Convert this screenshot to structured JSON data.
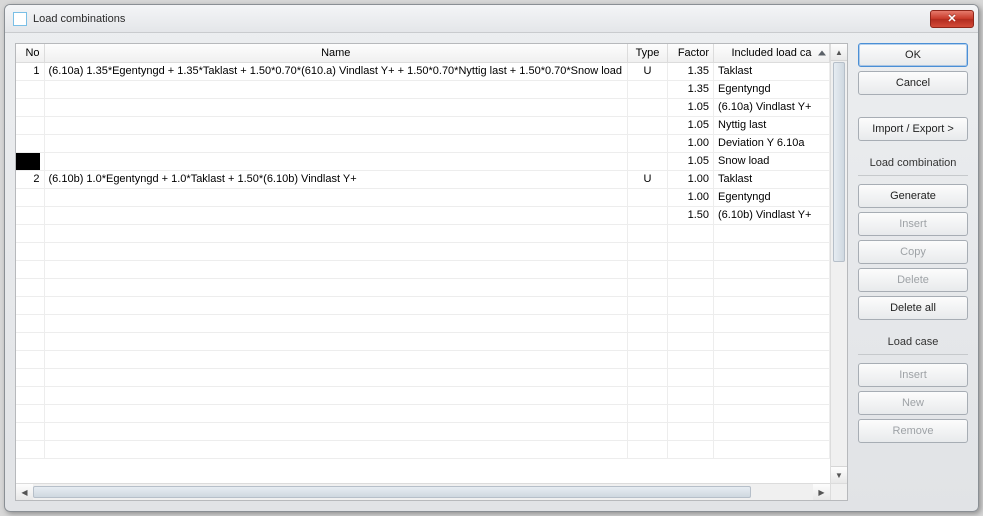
{
  "window": {
    "title": "Load combinations"
  },
  "table": {
    "headers": {
      "no": "No",
      "name": "Name",
      "type": "Type",
      "factor": "Factor",
      "included": "Included load ca"
    },
    "rows": [
      {
        "no": "1",
        "name": "(6.10a) 1.35*Egentyngd + 1.35*Taklast + 1.50*0.70*(610.a) Vindlast Y+ + 1.50*0.70*Nyttig last + 1.50*0.70*Snow load",
        "type": "U",
        "factor": "1.35",
        "included": "Taklast"
      },
      {
        "no": "",
        "name": "",
        "type": "",
        "factor": "1.35",
        "included": "Egentyngd"
      },
      {
        "no": "",
        "name": "",
        "type": "",
        "factor": "1.05",
        "included": "(6.10a) Vindlast Y+"
      },
      {
        "no": "",
        "name": "",
        "type": "",
        "factor": "1.05",
        "included": "Nyttig last"
      },
      {
        "no": "",
        "name": "",
        "type": "",
        "factor": "1.00",
        "included": "Deviation Y 6.10a"
      },
      {
        "no": "",
        "name": "",
        "type": "",
        "factor": "1.05",
        "included": "Snow load"
      },
      {
        "no": "2",
        "name": "(6.10b) 1.0*Egentyngd + 1.0*Taklast + 1.50*(6.10b) Vindlast Y+",
        "type": "U",
        "factor": "1.00",
        "included": "Taklast"
      },
      {
        "no": "",
        "name": "",
        "type": "",
        "factor": "1.00",
        "included": "Egentyngd"
      },
      {
        "no": "",
        "name": "",
        "type": "",
        "factor": "1.50",
        "included": "(6.10b) Vindlast Y+"
      }
    ]
  },
  "buttons": {
    "ok": "OK",
    "cancel": "Cancel",
    "import_export": "Import / Export >",
    "section_combo": "Load combination",
    "generate": "Generate",
    "insert_combo": "Insert",
    "copy": "Copy",
    "delete": "Delete",
    "delete_all": "Delete all",
    "section_case": "Load case",
    "insert_case": "Insert",
    "new": "New",
    "remove": "Remove"
  }
}
